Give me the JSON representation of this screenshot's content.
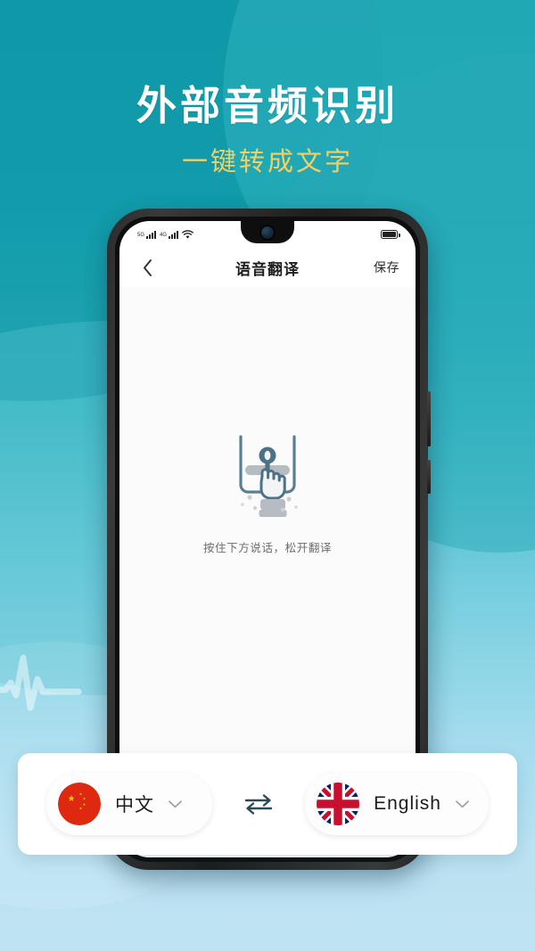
{
  "promo": {
    "headline": "外部音频识别",
    "subhead": "一键转成文字",
    "headline_color": "#ffffff",
    "subhead_color": "#f2cf63",
    "background_top_color": "#0e9bab",
    "background_bottom_color": "#bfe3f3"
  },
  "phone": {
    "status_bar": {
      "network_1": "5G",
      "network_2": "4G",
      "wifi_icon": "wifi-icon",
      "battery_icon": "battery-icon"
    },
    "nav": {
      "back_icon": "chevron-left-icon",
      "title": "语音翻译",
      "save_label": "保存"
    },
    "content": {
      "illustration_name": "press-and-hold-hand-icon",
      "hint": "按住下方说话，松开翻译"
    }
  },
  "language_bar": {
    "source": {
      "flag_icon": "flag-china-icon",
      "label": "中文",
      "chevron_icon": "chevron-down-icon"
    },
    "swap_icon": "swap-arrows-icon",
    "target": {
      "flag_icon": "flag-uk-icon",
      "label": "English",
      "chevron_icon": "chevron-down-icon"
    }
  },
  "decor": {
    "waveform_icon": "audio-waveform-icon"
  }
}
